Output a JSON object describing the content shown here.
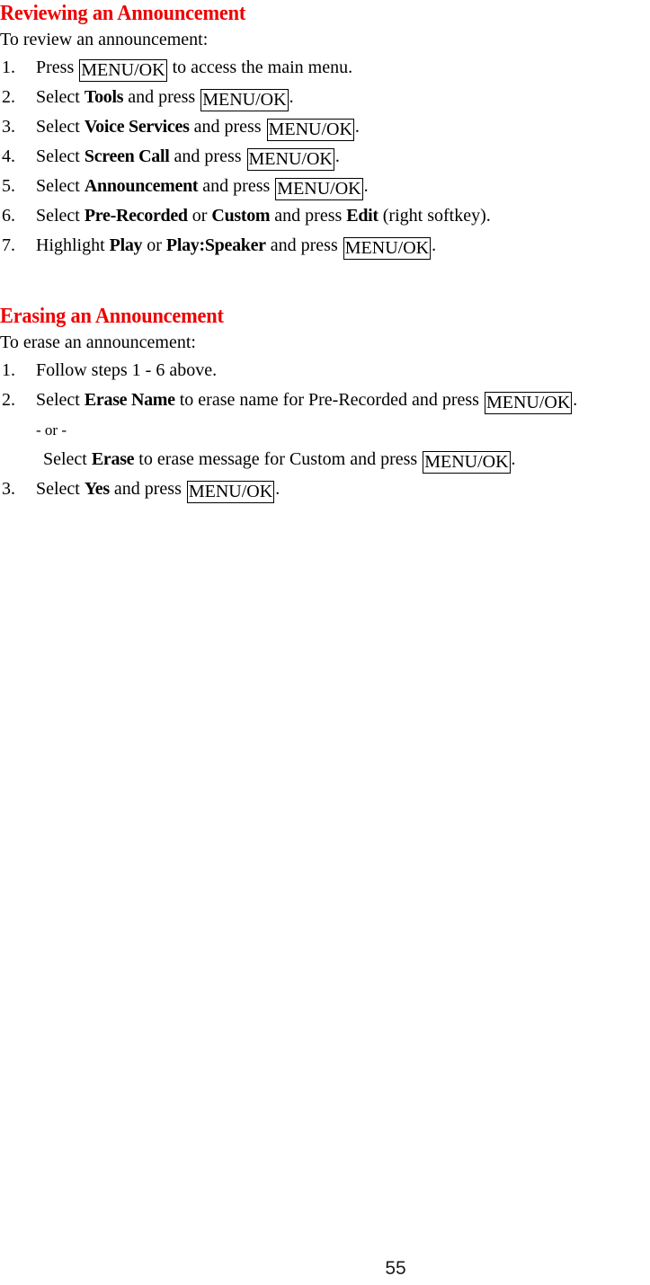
{
  "document": {
    "page_number": "55",
    "heading_color": "#ee0000",
    "text_color": "#000000",
    "background_color": "#ffffff"
  },
  "sections": [
    {
      "heading": "Reviewing an Announcement",
      "intro": "To review an announcement:",
      "steps": [
        {
          "num": "1.",
          "parts": [
            {
              "t": "Press ",
              "s": "normal"
            },
            {
              "t": "MENU/OK",
              "s": "boxed"
            },
            {
              "t": " to access the main menu.",
              "s": "normal"
            }
          ]
        },
        {
          "num": "2.",
          "parts": [
            {
              "t": "Select ",
              "s": "normal"
            },
            {
              "t": "Tools",
              "s": "bold"
            },
            {
              "t": " and press ",
              "s": "normal"
            },
            {
              "t": "MENU/OK",
              "s": "boxed"
            },
            {
              "t": ".",
              "s": "normal"
            }
          ]
        },
        {
          "num": "3.",
          "parts": [
            {
              "t": "Select ",
              "s": "normal"
            },
            {
              "t": "Voice Services",
              "s": "bold"
            },
            {
              "t": " and press ",
              "s": "normal"
            },
            {
              "t": "MENU/OK",
              "s": "boxed"
            },
            {
              "t": ".",
              "s": "normal"
            }
          ]
        },
        {
          "num": "4.",
          "parts": [
            {
              "t": "Select ",
              "s": "normal"
            },
            {
              "t": "Screen Call",
              "s": "bold"
            },
            {
              "t": " and press ",
              "s": "normal"
            },
            {
              "t": "MENU/OK",
              "s": "boxed"
            },
            {
              "t": ".",
              "s": "normal"
            }
          ]
        },
        {
          "num": "5.",
          "parts": [
            {
              "t": "Select ",
              "s": "normal"
            },
            {
              "t": "Announcement",
              "s": "bold"
            },
            {
              "t": " and press ",
              "s": "normal"
            },
            {
              "t": "MENU/OK",
              "s": "boxed"
            },
            {
              "t": ".",
              "s": "normal"
            }
          ]
        },
        {
          "num": "6.",
          "parts": [
            {
              "t": "Select ",
              "s": "normal"
            },
            {
              "t": "Pre-Recorded",
              "s": "bold"
            },
            {
              "t": " or ",
              "s": "normal"
            },
            {
              "t": "Custom",
              "s": "bold"
            },
            {
              "t": " and press ",
              "s": "normal"
            },
            {
              "t": "Edit",
              "s": "bold"
            },
            {
              "t": " (right softkey).",
              "s": "normal"
            }
          ]
        },
        {
          "num": "7.",
          "parts": [
            {
              "t": "Highlight ",
              "s": "normal"
            },
            {
              "t": "Play",
              "s": "bold"
            },
            {
              "t": " or ",
              "s": "normal"
            },
            {
              "t": "Play:Speaker",
              "s": "bold"
            },
            {
              "t": " and press ",
              "s": "normal"
            },
            {
              "t": "MENU/OK",
              "s": "boxed"
            },
            {
              "t": ".",
              "s": "normal"
            }
          ]
        }
      ]
    },
    {
      "heading": "Erasing an Announcement",
      "intro": "To erase an announcement:",
      "steps": [
        {
          "num": "1.",
          "parts": [
            {
              "t": "Follow steps 1 - 6 above.",
              "s": "normal"
            }
          ]
        },
        {
          "num": "2.",
          "parts": [
            {
              "t": "Select ",
              "s": "normal"
            },
            {
              "t": "Erase Name",
              "s": "bold"
            },
            {
              "t": " to erase name for Pre-Recorded and press ",
              "s": "normal"
            },
            {
              "t": "MENU/OK",
              "s": "boxed"
            },
            {
              "t": ".",
              "s": "normal"
            }
          ],
          "continuations": [
            {
              "indent": "or",
              "parts": [
                {
                  "t": "- or -",
                  "s": "normal"
                }
              ]
            },
            {
              "indent": "sub",
              "parts": [
                {
                  "t": "Select ",
                  "s": "normal"
                },
                {
                  "t": "Erase",
                  "s": "bold"
                },
                {
                  "t": " to erase message for Custom and press ",
                  "s": "normal"
                },
                {
                  "t": "MENU/OK",
                  "s": "boxed"
                },
                {
                  "t": ".",
                  "s": "normal"
                }
              ]
            }
          ]
        },
        {
          "num": "3.",
          "parts": [
            {
              "t": "Select ",
              "s": "normal"
            },
            {
              "t": "Yes",
              "s": "bold"
            },
            {
              "t": " and press ",
              "s": "normal"
            },
            {
              "t": "MENU/OK",
              "s": "boxed"
            },
            {
              "t": ".",
              "s": "normal"
            }
          ]
        }
      ]
    }
  ]
}
